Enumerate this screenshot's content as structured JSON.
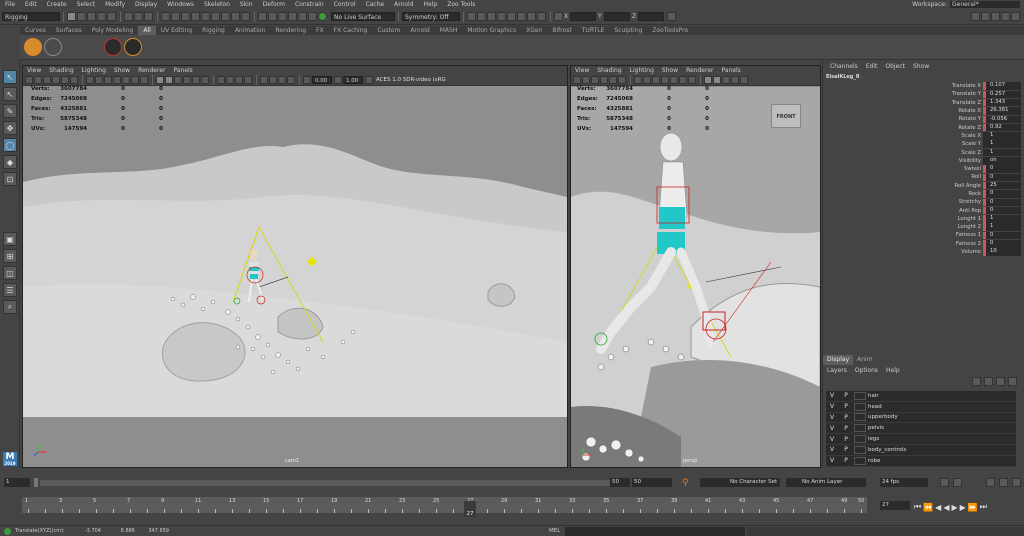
{
  "menubar": {
    "items": [
      "File",
      "Edit",
      "Create",
      "Select",
      "Modify",
      "Display",
      "Windows",
      "Skeleton",
      "Skin",
      "Deform",
      "Constrain",
      "Control",
      "Cache",
      "Arnold",
      "Help",
      "Zoo Tools"
    ],
    "workspace_label": "Workspace:",
    "workspace_value": "General*"
  },
  "statusline": {
    "menuset": "Rigging",
    "live_surface": "No Live Surface",
    "symmetry": "Symmetry: Off",
    "x_label": "X",
    "y_label": "Y",
    "z_label": "Z"
  },
  "shelf": {
    "tabs": [
      "Curves",
      "Surfaces",
      "Poly Modeling",
      "All",
      "UV Editing",
      "Rigging",
      "Animation",
      "Rendering",
      "FX",
      "FX Caching",
      "Custom",
      "Arnold",
      "MASH",
      "Motion Graphics",
      "XGen",
      "Bifrost",
      "TURTLE",
      "Sculpting",
      "ZooToolsPro"
    ],
    "active_tab": "All"
  },
  "viewport_left": {
    "menu": [
      "View",
      "Shading",
      "Lighting",
      "Show",
      "Renderer",
      "Panels"
    ],
    "exposure": "0.00",
    "gamma": "1.00",
    "colorspace": "ACES 1.0 SDR-video (sRG",
    "hud": [
      {
        "label": "Verts:",
        "v1": "3607784",
        "v2": "0",
        "v3": "0"
      },
      {
        "label": "Edges:",
        "v1": "7245068",
        "v2": "0",
        "v3": "0"
      },
      {
        "label": "Faces:",
        "v1": "4325881",
        "v2": "0",
        "v3": "0"
      },
      {
        "label": "Tris:",
        "v1": "5875348",
        "v2": "0",
        "v3": "0"
      },
      {
        "label": "UVs:",
        "v1": "147594",
        "v2": "0",
        "v3": "0"
      }
    ],
    "camera": "cam1"
  },
  "viewport_right": {
    "menu": [
      "View",
      "Shading",
      "Lighting",
      "Show",
      "Renderer",
      "Panels"
    ],
    "hud": [
      {
        "label": "Verts:",
        "v1": "3607784",
        "v2": "0",
        "v3": "0"
      },
      {
        "label": "Edges:",
        "v1": "7245068",
        "v2": "0",
        "v3": "0"
      },
      {
        "label": "Faces:",
        "v1": "4325881",
        "v2": "0",
        "v3": "0"
      },
      {
        "label": "Tris:",
        "v1": "5875348",
        "v2": "0",
        "v3": "0"
      },
      {
        "label": "UVs:",
        "v1": "147594",
        "v2": "0",
        "v3": "0"
      }
    ],
    "view_cube": "FRONT",
    "camera": "persp"
  },
  "channelbox": {
    "menu": [
      "Channels",
      "Edit",
      "Object",
      "Show"
    ],
    "object": "ElsaIKLeg_R",
    "attributes": [
      {
        "name": "Translate X",
        "value": "0.107",
        "keyed": true
      },
      {
        "name": "Translate Y",
        "value": "0.257",
        "keyed": true
      },
      {
        "name": "Translate Z",
        "value": "1.343",
        "keyed": true
      },
      {
        "name": "Rotate X",
        "value": "26.381",
        "keyed": true
      },
      {
        "name": "Rotate Y",
        "value": "-0.056",
        "keyed": true
      },
      {
        "name": "Rotate Z",
        "value": "0.92",
        "keyed": true
      },
      {
        "name": "Scale X",
        "value": "1",
        "keyed": false
      },
      {
        "name": "Scale Y",
        "value": "1",
        "keyed": false
      },
      {
        "name": "Scale Z",
        "value": "1",
        "keyed": false
      },
      {
        "name": "Visibility",
        "value": "on",
        "keyed": false
      },
      {
        "name": "Swivel",
        "value": "0",
        "keyed": true
      },
      {
        "name": "Roll",
        "value": "0",
        "keyed": true
      },
      {
        "name": "Roll Angle",
        "value": "25",
        "keyed": true
      },
      {
        "name": "Rock",
        "value": "0",
        "keyed": true
      },
      {
        "name": "Stretchy",
        "value": "0",
        "keyed": true
      },
      {
        "name": "Anti Pop",
        "value": "0",
        "keyed": true
      },
      {
        "name": "Lenght 1",
        "value": "1",
        "keyed": true
      },
      {
        "name": "Lenght 2",
        "value": "1",
        "keyed": true
      },
      {
        "name": "Fatness 1",
        "value": "0",
        "keyed": true
      },
      {
        "name": "Fatness 2",
        "value": "0",
        "keyed": true
      },
      {
        "name": "Volume",
        "value": "10",
        "keyed": true
      }
    ]
  },
  "layers": {
    "tabs": [
      "Display",
      "Anim"
    ],
    "active_tab": "Display",
    "menu": [
      "Layers",
      "Options",
      "Help"
    ],
    "items": [
      {
        "v": "V",
        "p": "P",
        "name": "hair"
      },
      {
        "v": "V",
        "p": "P",
        "name": "head"
      },
      {
        "v": "V",
        "p": "P",
        "name": "upperbody"
      },
      {
        "v": "V",
        "p": "P",
        "name": "pelvis"
      },
      {
        "v": "V",
        "p": "P",
        "name": "legs"
      },
      {
        "v": "V",
        "p": "P",
        "name": "body_controls"
      },
      {
        "v": "V",
        "p": "P",
        "name": "robe"
      }
    ]
  },
  "timeslider": {
    "range_start": "1",
    "range_inner_start": "1",
    "range_inner_end": "50",
    "range_end": "50",
    "character_set": "No Character Set",
    "anim_layer": "No Anim Layer",
    "fps": "24 fps",
    "current_frame": "27",
    "current_frame_field": "27",
    "ticks": [
      "1",
      "2",
      "3",
      "4",
      "5",
      "6",
      "7",
      "8",
      "9",
      "10",
      "11",
      "12",
      "13",
      "14",
      "15",
      "16",
      "17",
      "18",
      "19",
      "20",
      "21",
      "22",
      "23",
      "24",
      "25",
      "26",
      "27",
      "28",
      "29",
      "30",
      "31",
      "32",
      "33",
      "34",
      "35",
      "36",
      "37",
      "38",
      "39",
      "40",
      "41",
      "42",
      "43",
      "44",
      "45",
      "46",
      "47",
      "48",
      "49",
      "50"
    ]
  },
  "cmdline": {
    "translate_label": "Translate(XYZ)(cm):",
    "x": "-3.704",
    "y": "6.886",
    "z": "347.659",
    "mel_label": "MEL"
  }
}
